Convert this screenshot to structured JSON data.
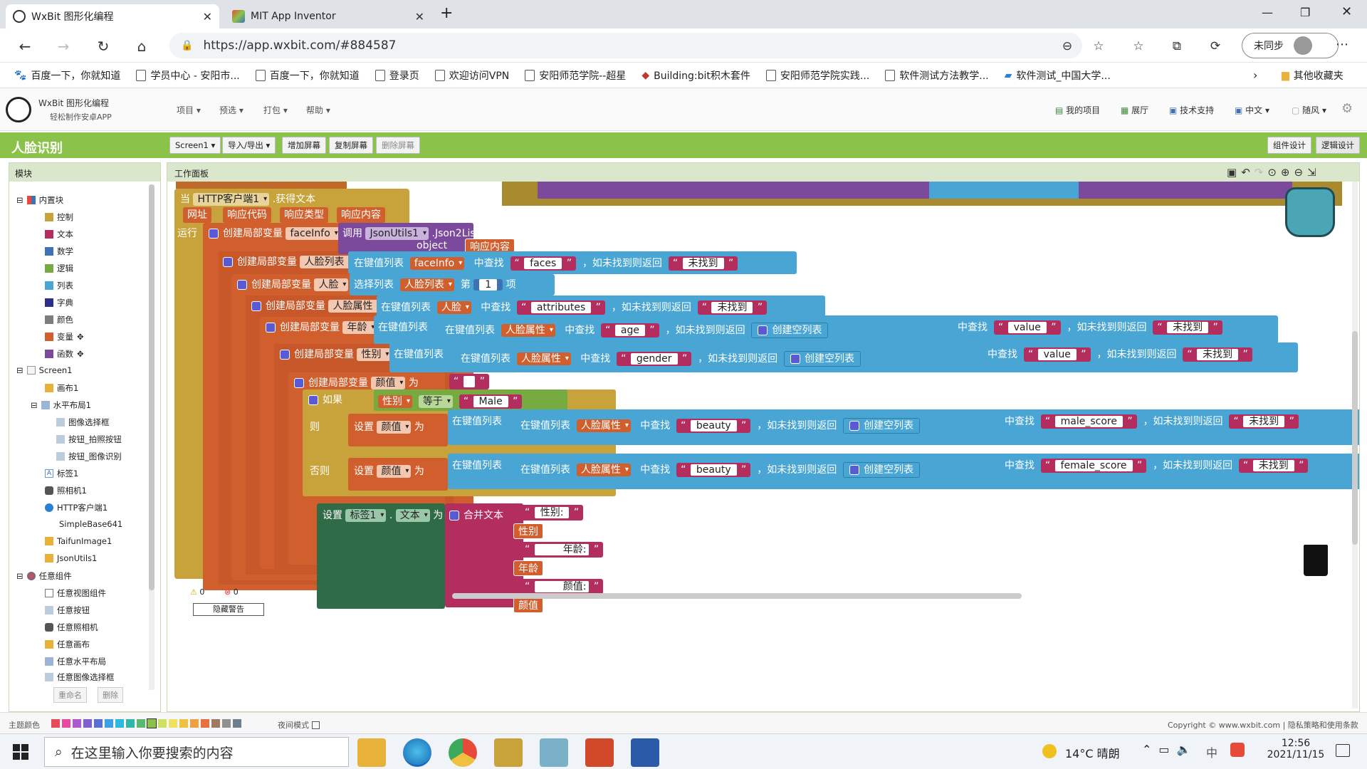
{
  "browser": {
    "tabs": [
      {
        "title": "WxBit 图形化编程",
        "active": true
      },
      {
        "title": "MIT App Inventor",
        "active": false
      }
    ],
    "url": "https://app.wxbit.com/#884587",
    "profile_label": "未同步",
    "bookmarks": [
      "百度一下，你就知道",
      "学员中心 - 安阳市...",
      "百度一下，你就知道",
      "登录页",
      "欢迎访问VPN",
      "安阳师范学院--超星",
      "Building:bit积木套件",
      "安阳师范学院实践...",
      "软件测试方法教学...",
      "软件测试_中国大学..."
    ],
    "other_bookmarks": "其他收藏夹"
  },
  "app": {
    "brand_title": "WxBit 图形化编程",
    "brand_subtitle": "轻松制作安卓APP",
    "menus": [
      "项目",
      "预选",
      "打包",
      "帮助"
    ],
    "right_links": [
      "我的项目",
      "展厅",
      "技术支持",
      "中文",
      "随风"
    ],
    "project_title": "人脸识别",
    "screen_select": "Screen1",
    "toolbar": [
      "导入/导出",
      "增加屏幕",
      "复制屏幕",
      "删除屏幕"
    ],
    "mode_buttons": [
      "组件设计",
      "逻辑设计"
    ],
    "accent": "#8bc34a"
  },
  "palette": {
    "title": "模块",
    "builtin_label": "内置块",
    "builtin": [
      {
        "label": "控制",
        "color": "#c8a23a"
      },
      {
        "label": "文本",
        "color": "#b32d5e"
      },
      {
        "label": "数学",
        "color": "#3f71b5"
      },
      {
        "label": "逻辑",
        "color": "#77ab41"
      },
      {
        "label": "列表",
        "color": "#49a6d4"
      },
      {
        "label": "字典",
        "color": "#2d2d8c"
      },
      {
        "label": "颜色",
        "color": "#7d7d7d"
      },
      {
        "label": "变量",
        "color": "#d05f2d"
      },
      {
        "label": "函数",
        "color": "#7b4a9c"
      }
    ],
    "screen_label": "Screen1",
    "components": [
      "画布1",
      "水平布局1",
      "图像选择框",
      "按钮_拍照按钮",
      "按钮_图像识别",
      "标签1",
      "照相机1",
      "HTTP客户端1",
      "SimpleBase641",
      "TaifunImage1",
      "JsonUtils1"
    ],
    "any_label": "任意组件",
    "any_components": [
      "任意视图组件",
      "任意按钮",
      "任意照相机",
      "任意画布",
      "任意水平布局",
      "任意图像选择框"
    ],
    "buttons": [
      "重命名",
      "删除"
    ]
  },
  "workspace": {
    "title": "工作面板",
    "warnings": "0",
    "errors": "0",
    "hide_warnings": "隐藏警告",
    "event": {
      "when": "当",
      "component": "HTTP客户端1",
      "event": "获得文本",
      "params": [
        "网址",
        "响应代码",
        "响应类型",
        "响应内容"
      ],
      "do": "运行"
    },
    "kw": {
      "create_local": "创建局部变量",
      "as": "为",
      "call": "调用",
      "object": "object",
      "in_dict": "在键值列表",
      "find": "中查找",
      "not_found": "，如未找到则返回",
      "select_list": "选择列表",
      "index_of": "第",
      "item": "项",
      "create_empty": "创建空列表",
      "if": "如果",
      "then": "则",
      "else": "否则",
      "set": "设置",
      "equals": "等于",
      "join": "合并文本",
      "text_prop": "文本",
      "dot": "."
    },
    "vars": {
      "faceInfo": "faceInfo",
      "faceList": "人脸列表",
      "face": "人脸",
      "attrs": "人脸属性",
      "age": "年龄",
      "gender": "性别",
      "beauty_var": "颜值"
    },
    "call_target": "JsonUtils1",
    "call_method": "Json2List",
    "response": "响应内容",
    "strings": {
      "faces": "faces",
      "not_found": "未找到",
      "attributes": "attributes",
      "age": "age",
      "value": "value",
      "gender": "gender",
      "male": "Male",
      "beauty": "beauty",
      "male_score": "male_score",
      "female_score": "female_score",
      "gender_label": "性别:",
      "age_label": "年龄:",
      "beauty_label": "颜值:"
    },
    "index_value": "1",
    "label_component": "标签1"
  },
  "footer": {
    "theme_label": "主题颜色",
    "night_mode": "夜间模式",
    "copyright": "Copyright © www.wxbit.com | 隐私策略和使用条款"
  },
  "taskbar": {
    "search_placeholder": "在这里输入你要搜索的内容",
    "weather": "14°C 晴朗",
    "time": "12:56",
    "date": "2021/11/15",
    "ime": "中"
  }
}
